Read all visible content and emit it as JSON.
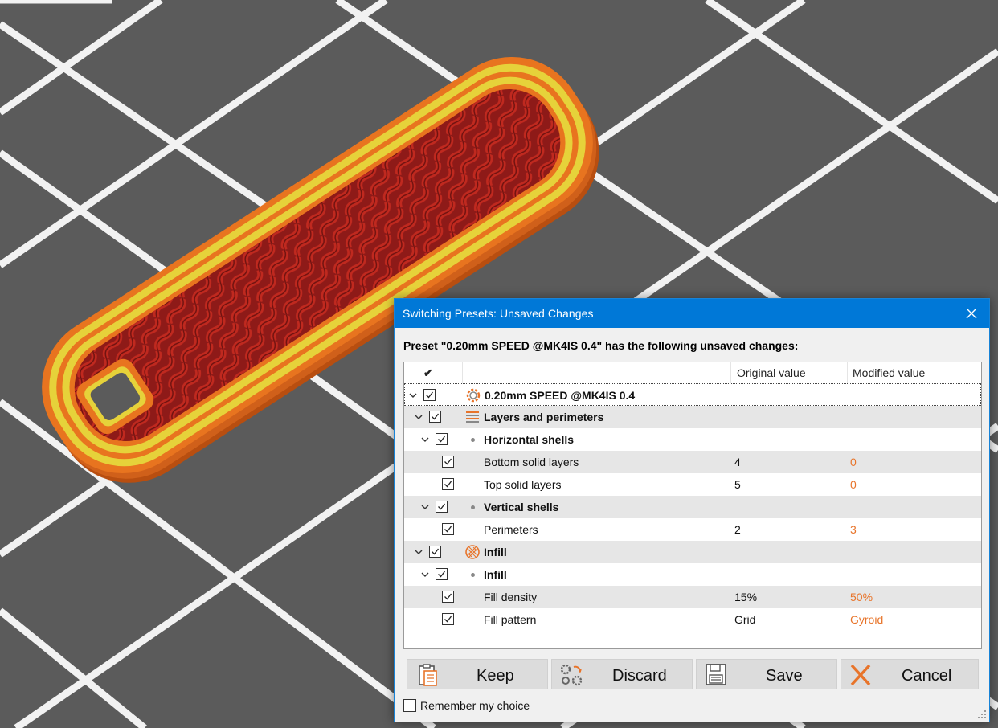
{
  "dialog": {
    "title": "Switching Presets: Unsaved Changes",
    "heading": "Preset \"0.20mm SPEED @MK4IS 0.4\" has the following unsaved changes:",
    "columns": {
      "check": "✔",
      "original": "Original value",
      "modified": "Modified value"
    },
    "rows": [
      {
        "label": "0.20mm SPEED @MK4IS 0.4",
        "original": "",
        "modified": "",
        "icon": "gear-icon"
      },
      {
        "label": "Layers and perimeters",
        "original": "",
        "modified": "",
        "icon": "layers-icon"
      },
      {
        "label": "Horizontal shells",
        "original": "",
        "modified": ""
      },
      {
        "label": "Bottom solid layers",
        "original": "4",
        "modified": "0"
      },
      {
        "label": "Top solid layers",
        "original": "5",
        "modified": "0"
      },
      {
        "label": "Vertical shells",
        "original": "",
        "modified": ""
      },
      {
        "label": "Perimeters",
        "original": "2",
        "modified": "3"
      },
      {
        "label": "Infill",
        "original": "",
        "modified": "",
        "icon": "infill-icon"
      },
      {
        "label": "Infill",
        "original": "",
        "modified": ""
      },
      {
        "label": "Fill density",
        "original": "15%",
        "modified": "50%"
      },
      {
        "label": "Fill pattern",
        "original": "Grid",
        "modified": "Gyroid"
      }
    ],
    "buttons": {
      "keep": "Keep",
      "discard": "Discard",
      "save": "Save",
      "cancel": "Cancel"
    },
    "remember_label": "Remember my choice",
    "remember_checked": false
  },
  "colors": {
    "accent": "#0078d7",
    "modified_value": "#e8742a",
    "infill": "#a8201c",
    "perimeter_outer": "#e8741f",
    "perimeter_inner": "#e6d23a",
    "bed": "#5b5b5b"
  }
}
